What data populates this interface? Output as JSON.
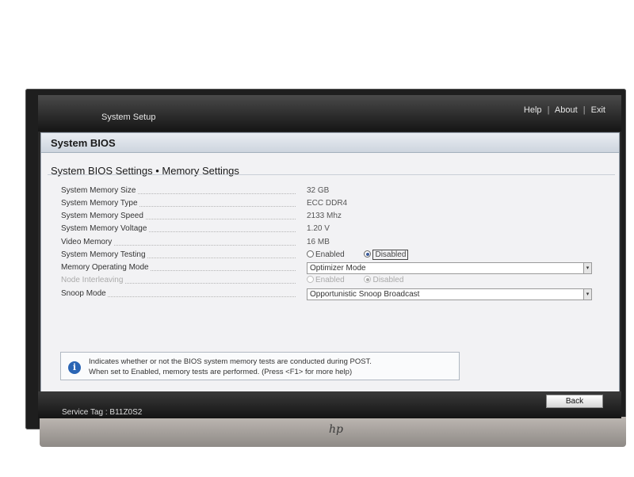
{
  "header": {
    "title": "System Setup",
    "links": [
      "Help",
      "About",
      "Exit"
    ],
    "separator": "|"
  },
  "panel": {
    "title": "System BIOS",
    "breadcrumb": "System BIOS Settings • Memory Settings"
  },
  "settings": [
    {
      "label": "System Memory Size",
      "value": "32 GB"
    },
    {
      "label": "System Memory Type",
      "value": "ECC DDR4"
    },
    {
      "label": "System Memory Speed",
      "value": "2133 Mhz"
    },
    {
      "label": "System Memory Voltage",
      "value": "1.20 V"
    },
    {
      "label": "Video Memory",
      "value": "16 MB"
    },
    {
      "label": "System Memory Testing",
      "options": [
        "Enabled",
        "Disabled"
      ],
      "selected": "Disabled"
    },
    {
      "label": "Memory Operating Mode",
      "select": "Optimizer Mode"
    },
    {
      "label": "Node Interleaving",
      "options": [
        "Enabled",
        "Disabled"
      ],
      "selected": "Disabled",
      "disabled": true
    },
    {
      "label": "Snoop Mode",
      "select": "Opportunistic Snoop Broadcast"
    }
  ],
  "info": {
    "icon": "info-icon",
    "line1": "Indicates whether or not the BIOS system memory tests are conducted during POST.",
    "line2": "When set to Enabled, memory tests are performed. (Press <F1> for more help)"
  },
  "footer": {
    "back_label": "Back",
    "service_tag": "Service Tag : B11Z0S2"
  },
  "monitor": {
    "logo": "hp"
  },
  "colors": {
    "info_icon": "#2a65b4",
    "radio_selected": "#3a5a9a"
  }
}
